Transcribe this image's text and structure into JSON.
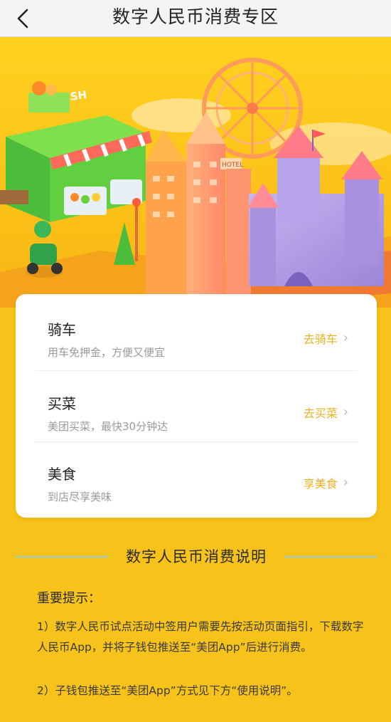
{
  "header": {
    "title": "数字人民币消费专区",
    "back_icon": "chevron-left-icon"
  },
  "hero": {
    "shop_sign": "RESH",
    "hotel_sign": "HOTEL"
  },
  "services": [
    {
      "title": "骑车",
      "subtitle": "用车免押金，方便又便宜",
      "action": "去骑车"
    },
    {
      "title": "买菜",
      "subtitle": "美团买菜，最快30分钟达",
      "action": "去买菜"
    },
    {
      "title": "美食",
      "subtitle": "到店尽享美味",
      "action": "享美食"
    }
  ],
  "chevron": "›",
  "explanation": {
    "title": "数字人民币消费说明",
    "notice_title": "重要提示：",
    "paragraphs": [
      "1）数字人民币试点活动中签用户需要先按活动页面指引，下载数字人民币App，并将子钱包推送至“美团App”后进行消费。",
      "2）子钱包推送至“美团App”方式见下方“使用说明”。"
    ]
  },
  "colors": {
    "background": "#f7c21a",
    "action_text": "#e9b324",
    "divider_line": "#8fcde3"
  }
}
